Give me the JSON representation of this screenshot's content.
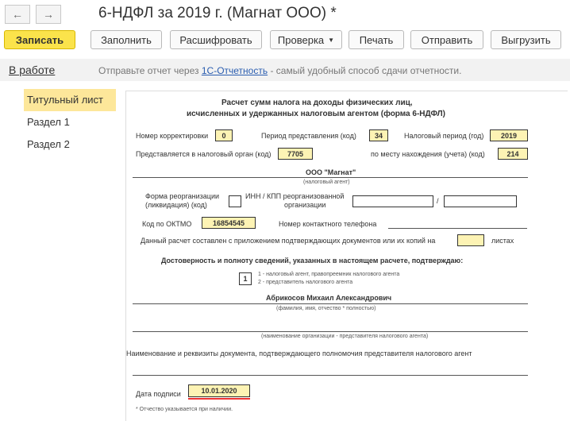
{
  "header": {
    "title": "6-НДФЛ за 2019 г. (Магнат ООО) *",
    "back_icon": "arrow-left",
    "forward_icon": "arrow-right"
  },
  "toolbar": {
    "save": "Записать",
    "fill": "Заполнить",
    "decode": "Расшифровать",
    "check": "Проверка",
    "print": "Печать",
    "send": "Отправить",
    "upload": "Выгрузить"
  },
  "status": {
    "state": "В работе",
    "msg_pre": "Отправьте отчет через",
    "msg_link": "1С-Отчетность",
    "msg_post": "- самый удобный способ сдачи отчетности."
  },
  "sidebar": {
    "items": [
      {
        "label": "Титульный лист"
      },
      {
        "label": "Раздел 1"
      },
      {
        "label": "Раздел 2"
      }
    ]
  },
  "form": {
    "title1": "Расчет сумм налога на доходы физических лиц,",
    "title2": "исчисленных и удержанных налоговым агентом (форма 6-НДФЛ)",
    "corr_label": "Номер корректировки",
    "corr": "0",
    "period_label": "Период представления (код)",
    "period": "34",
    "taxperiod_label": "Налоговый период (год)",
    "taxperiod": "2019",
    "org_label": "Представляется в налоговый орган (код)",
    "org": "7705",
    "place_label": "по месту нахождения (учета) (код)",
    "place": "214",
    "company": "ООО \"Магнат\"",
    "company_caption": "(налоговый агент)",
    "reorg_label1": "Форма реорганизации",
    "reorg_label2": "(ликвидация) (код)",
    "inn_label1": "ИНН / КПП реорганизованной",
    "inn_label2": "организации",
    "slash": "/",
    "oktmo_label": "Код по ОКТМО",
    "oktmo": "16854545",
    "phone_label": "Номер контактного телефона",
    "pages_label": "Данный расчет составлен с приложением подтверждающих документов или их копий на",
    "pages_suffix": "листах",
    "confirm": "Достоверность и полноту сведений, указанных в настоящем расчете, подтверждаю:",
    "signer": "1",
    "signer_opt1": "1 - налоговый агент, правопреемник налогового агента",
    "signer_opt2": "2 - представитель налогового агента",
    "fio": "Абрикосов Михаил Александрович",
    "fio_caption": "(фамилия, имя, отчество * полностью)",
    "rep_caption": "(наименование организации - представителя налогового агента)",
    "doc_label": "Наименование и реквизиты документа, подтверждающего полномочия представителя налогового агент",
    "date_label": "Дата подписи",
    "date": "10.01.2020",
    "footnote": "* Отчество указывается при наличии."
  }
}
